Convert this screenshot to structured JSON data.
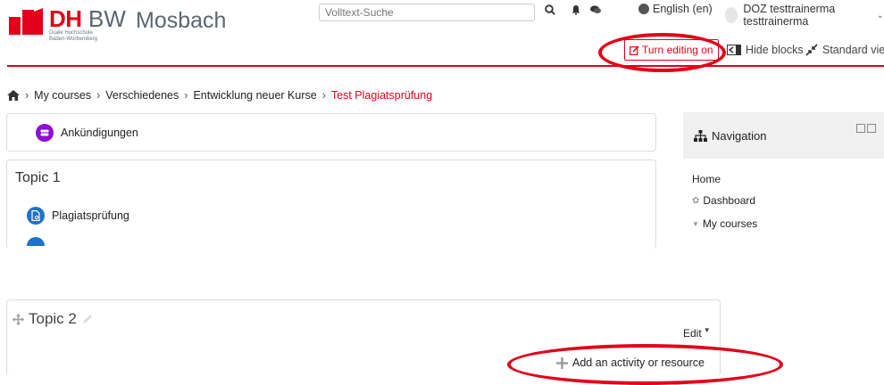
{
  "header": {
    "logo_dh": "DH",
    "logo_bw": "BW",
    "logo_city": "Mosbach",
    "logo_sub_1": "Duale Hochschule",
    "logo_sub_2": "Baden-Württemberg",
    "search_placeholder": "Volltext-Suche",
    "language": "English (en)",
    "user_name": "DOZ testtrainerma testtrainerma",
    "turn_editing_on": "Turn editing on",
    "hide_blocks": "Hide blocks",
    "standard_view": "Standard view"
  },
  "breadcrumb": {
    "items": [
      "My courses",
      "Verschiedenes",
      "Entwicklung neuer Kurse"
    ],
    "current": "Test Plagiatsprüfung"
  },
  "course": {
    "announcements": "Ankündigungen",
    "topic1_title": "Topic 1",
    "topic1_activity": "Plagiatsprüfung",
    "topic2_title": "Topic 2",
    "topic2_edit": "Edit",
    "add_activity": "Add an activity or resource"
  },
  "navigation": {
    "title": "Navigation",
    "items": [
      "Home",
      "Dashboard",
      "My courses"
    ]
  },
  "colors": {
    "brand_red": "#e2001a",
    "activity_purple": "#8f0fd4",
    "activity_blue": "#1e73c8"
  }
}
